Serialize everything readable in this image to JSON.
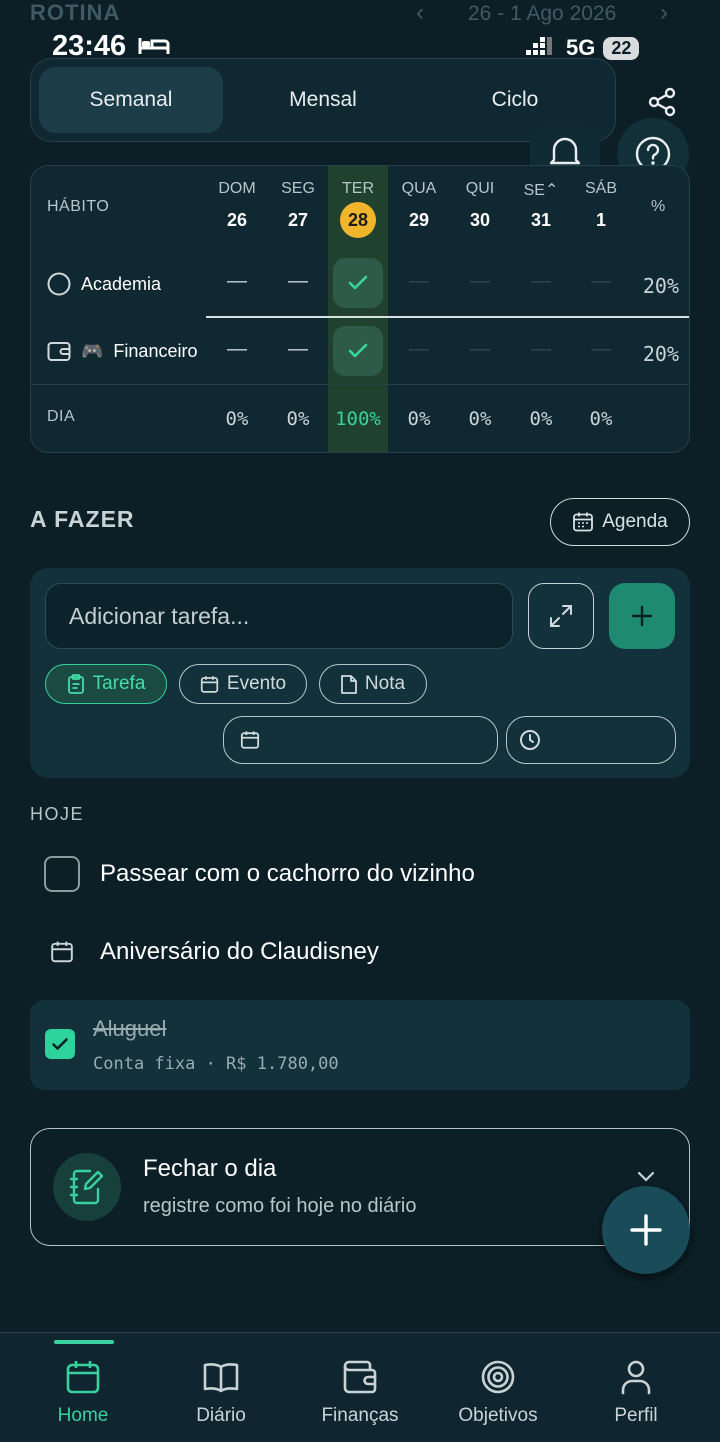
{
  "header": {
    "title": "ROTINA",
    "range": "26 - 1 Ago 2026",
    "prev": "‹",
    "next": "›"
  },
  "status": {
    "time": "23:46",
    "network": "5G",
    "battery": "22"
  },
  "tabs": [
    {
      "label": "Semanal"
    },
    {
      "label": "Mensal"
    },
    {
      "label": "Ciclo"
    }
  ],
  "habits_table": {
    "col_habit": "HÁBITO",
    "col_pct": "%",
    "days": [
      {
        "name": "DOM",
        "num": "26"
      },
      {
        "name": "SEG",
        "num": "27"
      },
      {
        "name": "TER",
        "num": "28"
      },
      {
        "name": "QUA",
        "num": "29"
      },
      {
        "name": "QUI",
        "num": "30"
      },
      {
        "name": "SE⌃",
        "num": "31"
      },
      {
        "name": "SÁB",
        "num": "1"
      }
    ],
    "habits": [
      {
        "name": "Academia",
        "pct": "20%"
      },
      {
        "name": "Financeiro",
        "emoji": "🎮",
        "pct": "20%"
      }
    ],
    "row_day": "DIA",
    "day_pcts": [
      "0%",
      "0%",
      "100%",
      "0%",
      "0%",
      "0%",
      "0%"
    ]
  },
  "todo": {
    "title": "A FAZER",
    "agenda_label": "Agenda",
    "input_placeholder": "Adicionar tarefa...",
    "chips": [
      {
        "label": "Tarefa"
      },
      {
        "label": "Evento"
      },
      {
        "label": "Nota"
      }
    ]
  },
  "today": {
    "heading": "HOJE",
    "items": [
      {
        "text": "Passear com o cachorro do vizinho"
      },
      {
        "text": "Aniversário do Claudisney"
      }
    ],
    "done": {
      "title": "Aluguel",
      "sub": "Conta fixa · R$ 1.780,00"
    }
  },
  "close_day": {
    "title": "Fechar o dia",
    "sub": "registre como foi hoje no diário"
  },
  "nav": [
    {
      "label": "Home",
      "icon": "calendar-icon"
    },
    {
      "label": "Diário",
      "icon": "book-icon"
    },
    {
      "label": "Finanças",
      "icon": "wallet-icon"
    },
    {
      "label": "Objetivos",
      "icon": "target-icon"
    },
    {
      "label": "Perfil",
      "icon": "user-icon"
    }
  ],
  "colors": {
    "accent": "#38d19e",
    "today": "#f1b52c",
    "bg": "#0c1f27"
  }
}
